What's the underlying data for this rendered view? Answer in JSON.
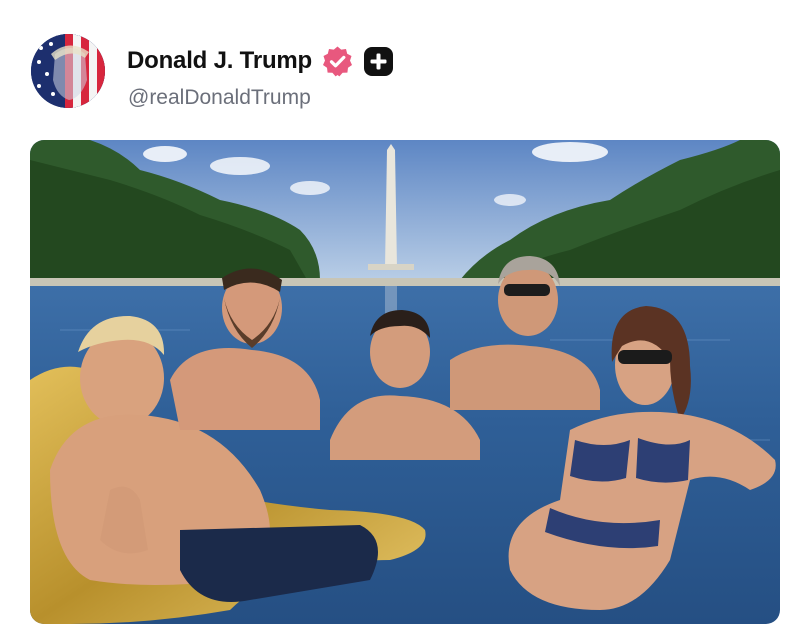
{
  "post": {
    "author": {
      "display_name": "Donald J. Trump",
      "handle": "@realDonaldTrump",
      "avatar_icon": "flag-portrait-avatar",
      "verified_icon": "verified-badge-icon",
      "subscription_icon": "plus-badge-icon"
    },
    "media": {
      "type": "image",
      "subject_icon": "reflecting-pool-photo"
    }
  },
  "colors": {
    "verified_badge": "#e8587e",
    "plus_badge": "#111111",
    "name_text": "#111111",
    "handle_text": "#6b6f7a"
  }
}
